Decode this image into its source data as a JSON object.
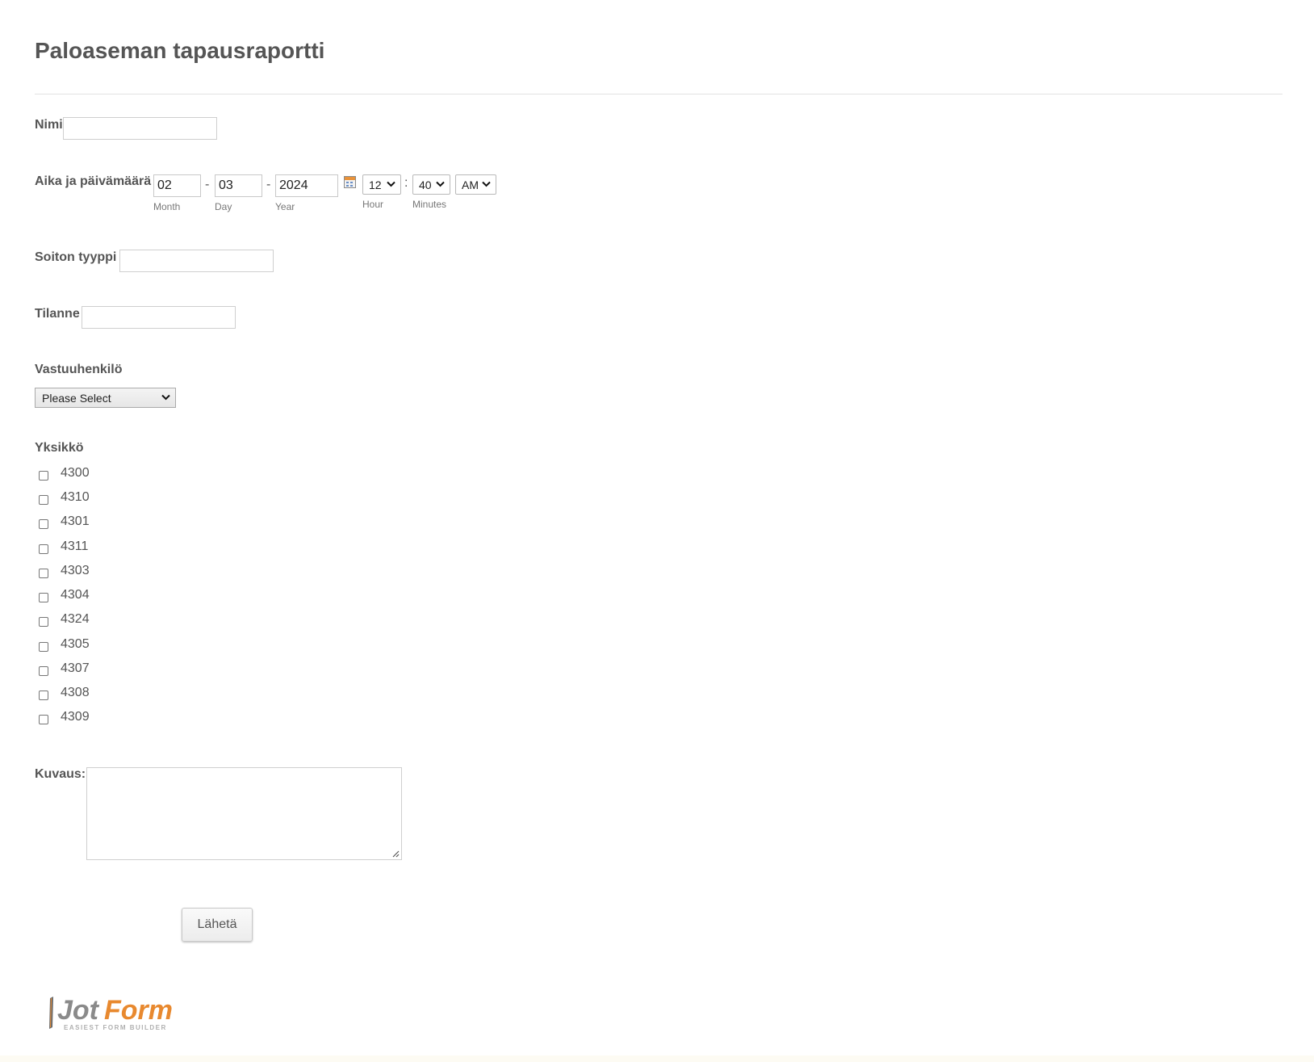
{
  "form": {
    "title": "Paloaseman tapausraportti",
    "fields": {
      "name": {
        "label": "Nimi",
        "value": ""
      },
      "datetime": {
        "label": "Aika ja päivämäärä",
        "month": "02",
        "day": "03",
        "year": "2024",
        "date_separator": "-",
        "time_separator": ":",
        "month_label": "Month",
        "day_label": "Day",
        "year_label": "Year",
        "hour": "12",
        "minutes": "40",
        "ampm": "AM",
        "hour_label": "Hour",
        "minutes_label": "Minutes"
      },
      "call_type": {
        "label": "Soiton tyyppi",
        "value": ""
      },
      "status": {
        "label": "Tilanne",
        "value": ""
      },
      "responsible": {
        "label": "Vastuuhenkilö",
        "selected": "Please Select"
      },
      "unit": {
        "label": "Yksikkö",
        "options": [
          "4300",
          "4310",
          "4301",
          "4311",
          "4303",
          "4304",
          "4324",
          "4305",
          "4307",
          "4308",
          "4309"
        ]
      },
      "description": {
        "label": "Kuvaus:",
        "value": ""
      }
    },
    "submit_label": "Lähetä"
  },
  "branding": {
    "logo_text": "JotForm",
    "logo_tagline": "EASIEST FORM BUILDER"
  },
  "icons": {
    "calendar": "calendar-icon",
    "dropdown": "chevron-down-icon",
    "resize": "resize-grip-icon"
  },
  "colors": {
    "text": "#555555",
    "logo_orange": "#e8892f",
    "logo_gray": "#8a8a8a"
  }
}
